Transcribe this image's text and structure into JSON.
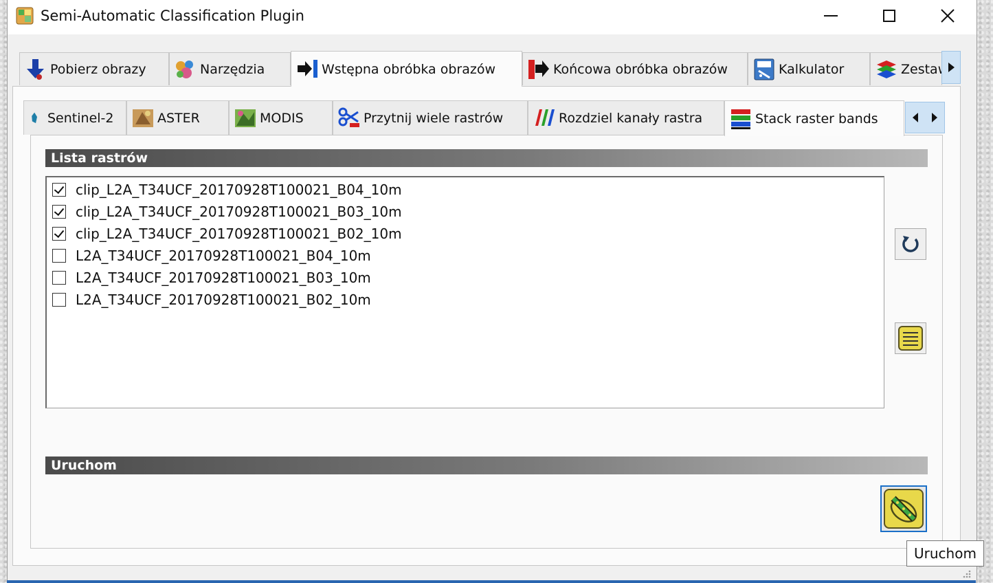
{
  "window": {
    "title": "Semi-Automatic Classification Plugin"
  },
  "main_tabs": [
    {
      "label": "Pobierz obrazy",
      "icon": "download-arrow-icon"
    },
    {
      "label": "Narzędzia",
      "icon": "tools-icon"
    },
    {
      "label": "Wstępna obróbka obrazów",
      "icon": "preprocessing-icon",
      "active": true
    },
    {
      "label": "Końcowa obróbka obrazów",
      "icon": "postprocessing-icon"
    },
    {
      "label": "Kalkulator",
      "icon": "calculator-icon"
    },
    {
      "label": "Zestaw",
      "icon": "band-set-icon"
    }
  ],
  "sub_tabs": [
    {
      "label": "Sentinel-2",
      "icon": "sentinel-icon"
    },
    {
      "label": "ASTER",
      "icon": "aster-icon"
    },
    {
      "label": "MODIS",
      "icon": "modis-icon"
    },
    {
      "label": "Przytnij wiele rastrów",
      "icon": "clip-scissors-icon"
    },
    {
      "label": "Rozdziel kanały rastra",
      "icon": "split-bands-icon"
    },
    {
      "label": "Stack raster bands",
      "icon": "stack-bands-icon",
      "active": true
    }
  ],
  "raster_section": {
    "header": "Lista rastrów",
    "items": [
      {
        "name": "clip_L2A_T34UCF_20170928T100021_B04_10m",
        "checked": true
      },
      {
        "name": "clip_L2A_T34UCF_20170928T100021_B03_10m",
        "checked": true
      },
      {
        "name": "clip_L2A_T34UCF_20170928T100021_B02_10m",
        "checked": true
      },
      {
        "name": "L2A_T34UCF_20170928T100021_B04_10m",
        "checked": false
      },
      {
        "name": "L2A_T34UCF_20170928T100021_B03_10m",
        "checked": false
      },
      {
        "name": "L2A_T34UCF_20170928T100021_B02_10m",
        "checked": false
      }
    ]
  },
  "run_section": {
    "header": "Uruchom",
    "tooltip": "Uruchom"
  },
  "colors": {
    "accent_blue": "#1a6fc8",
    "header_dark": "#4b4b4b",
    "button_yellow": "#e8d84a"
  }
}
